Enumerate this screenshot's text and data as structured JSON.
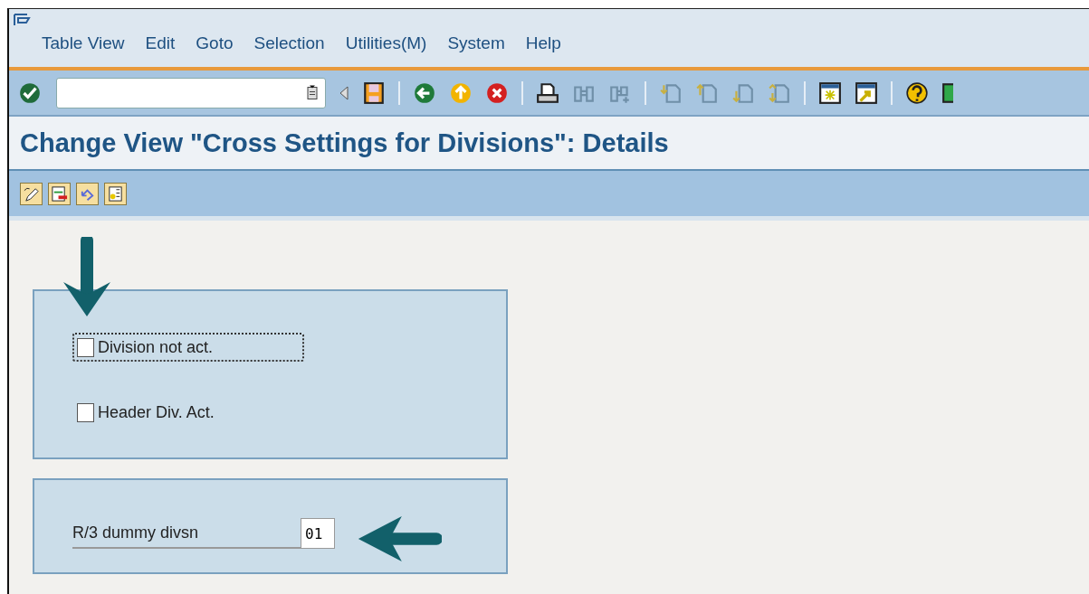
{
  "menu_bar": {
    "items": [
      {
        "label": "Table View"
      },
      {
        "label": "Edit"
      },
      {
        "label": "Goto"
      },
      {
        "label": "Selection"
      },
      {
        "label": "Utilities(M)"
      },
      {
        "label": "System"
      },
      {
        "label": "Help"
      }
    ]
  },
  "title": "Change View \"Cross Settings for Divisions\": Details",
  "group_1": {
    "checkboxes": [
      {
        "label": "Division not act.",
        "checked": false,
        "focused": true
      },
      {
        "label": "Header Div. Act.",
        "checked": false,
        "focused": false
      }
    ]
  },
  "group_2": {
    "field": {
      "label": "R/3 dummy divsn",
      "value": "01"
    }
  }
}
